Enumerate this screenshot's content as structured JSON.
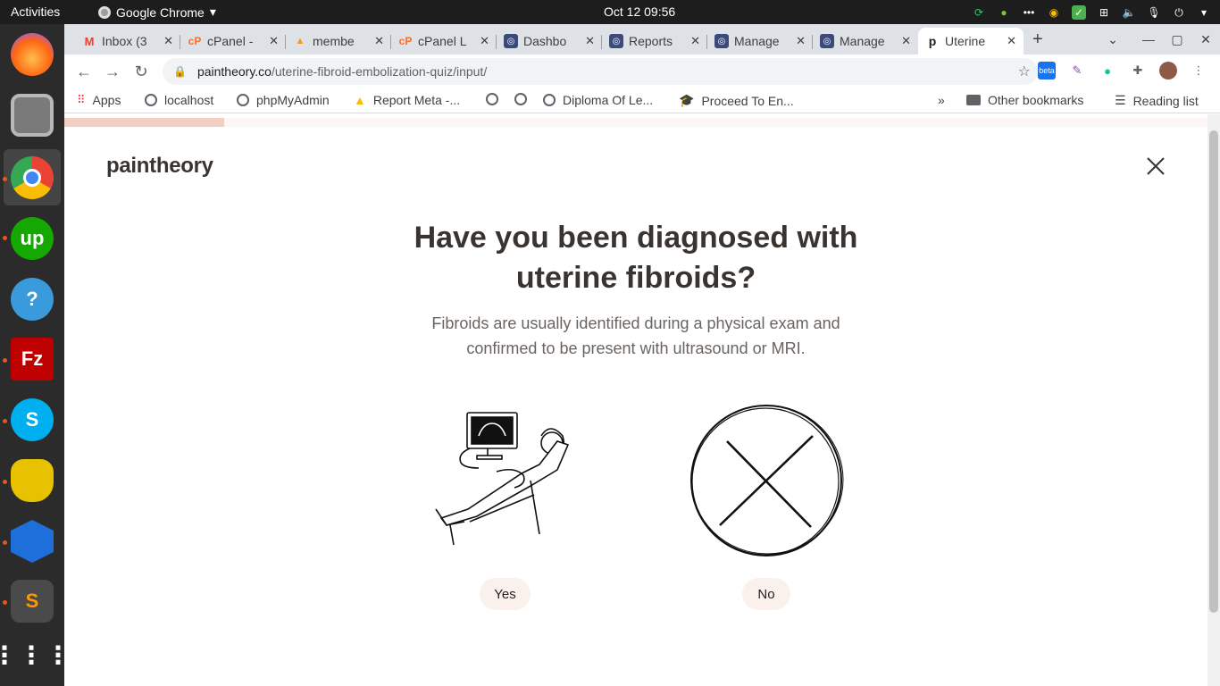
{
  "system": {
    "activities": "Activities",
    "app_name": "Google Chrome",
    "clock": "Oct 12  09:56"
  },
  "tabs": [
    {
      "label": "Inbox (3",
      "favicon": "gmail-icon",
      "color": "#ea4335"
    },
    {
      "label": "cPanel -",
      "favicon": "cpanel-icon",
      "color": "#ff6c2c"
    },
    {
      "label": "membe",
      "favicon": "phpmyadmin-icon",
      "color": "#f39c12"
    },
    {
      "label": "cPanel L",
      "favicon": "cpanel-icon",
      "color": "#ff6c2c"
    },
    {
      "label": "Dashbo",
      "favicon": "dashboard-icon",
      "color": "#3b4a7a"
    },
    {
      "label": "Reports",
      "favicon": "dashboard-icon",
      "color": "#3b4a7a"
    },
    {
      "label": "Manage",
      "favicon": "dashboard-icon",
      "color": "#3b4a7a"
    },
    {
      "label": "Manage",
      "favicon": "dashboard-icon",
      "color": "#3b4a7a"
    },
    {
      "label": "Uterine",
      "favicon": "paintheory-icon",
      "color": "#222222"
    }
  ],
  "address": {
    "domain": "paintheory.co",
    "path": "/uterine-fibroid-embolization-quiz/input/"
  },
  "bookmarks": {
    "apps": "Apps",
    "items": [
      "localhost",
      "phpMyAdmin",
      "Report Meta -...",
      "",
      "",
      "Diploma Of Le...",
      "Proceed To En..."
    ],
    "more": "»",
    "other": "Other bookmarks",
    "reading": "Reading list"
  },
  "extensions": {
    "beta": "beta"
  },
  "page": {
    "logo": "paintheory",
    "question": "Have you been diagnosed with uterine fibroids?",
    "subtitle": "Fibroids are usually identified during a physical exam and confirmed to be present with ultrasound or MRI.",
    "progress": 0.14,
    "answers": [
      {
        "label": "Yes"
      },
      {
        "label": "No"
      }
    ]
  },
  "colors": {
    "accent": "#f2cfc3",
    "button_bg": "#fbf1ec",
    "text_dark": "#3a3431"
  }
}
